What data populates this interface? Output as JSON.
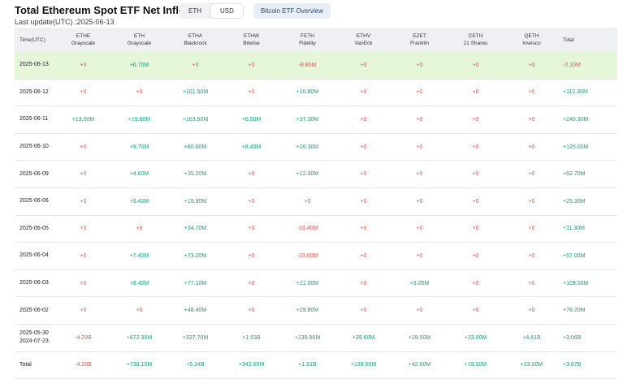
{
  "header": {
    "title": "Total Ethereum Spot ETF Net Inflow USD",
    "toggle": [
      "ETH",
      "USD"
    ],
    "toggle_active": "USD",
    "overview_button": "Bitcoin ETF Overview",
    "last_update": "Last update(UTC) :2025-06-13"
  },
  "colors": {
    "positive": "#17a37a",
    "negative": "#e05555",
    "highlight_row": "#e6f7d9",
    "header_bg": "#eef0f3"
  },
  "table": {
    "columns": [
      {
        "ticker": "Time(UTC)",
        "issuer": ""
      },
      {
        "ticker": "ETHE",
        "issuer": "Grayscale"
      },
      {
        "ticker": "ETH",
        "issuer": "Grayscale"
      },
      {
        "ticker": "ETHA",
        "issuer": "Blackrock"
      },
      {
        "ticker": "ETHW",
        "issuer": "Bitwise"
      },
      {
        "ticker": "FETH",
        "issuer": "Fidelity"
      },
      {
        "ticker": "ETHV",
        "issuer": "VanEck"
      },
      {
        "ticker": "EZET",
        "issuer": "Franklin"
      },
      {
        "ticker": "CETH",
        "issuer": "21 Shares"
      },
      {
        "ticker": "QETH",
        "issuer": "Invesco"
      },
      {
        "ticker": "Total",
        "issuer": ""
      }
    ],
    "rows": [
      {
        "date": [
          "2025-06-13"
        ],
        "values": [
          "+0",
          "+6.70M",
          "+0",
          "+0",
          "-8.80M",
          "+0",
          "+0",
          "+0",
          "+0",
          "-2.10M"
        ],
        "highlight": true
      },
      {
        "date": [
          "2025-06-12"
        ],
        "values": [
          "+0",
          "+0",
          "+101.50M",
          "+0",
          "+10.80M",
          "+0",
          "+0",
          "+0",
          "+0",
          "+112.30M"
        ]
      },
      {
        "date": [
          "2025-06-11"
        ],
        "values": [
          "+13.30M",
          "+19.60M",
          "+163.60M",
          "+6.50M",
          "+37.30M",
          "+0",
          "+0",
          "+0",
          "+0",
          "+240.30M"
        ]
      },
      {
        "date": [
          "2025-06-10"
        ],
        "values": [
          "+0",
          "+9.70M",
          "+80.60M",
          "+8.40M",
          "+26.30M",
          "+0",
          "+0",
          "+0",
          "+0",
          "+125.00M"
        ]
      },
      {
        "date": [
          "2025-06-09"
        ],
        "values": [
          "+0",
          "+4.60M",
          "+35.20M",
          "+0",
          "+12.90M",
          "+0",
          "+0",
          "+0",
          "+0",
          "+52.70M"
        ]
      },
      {
        "date": [
          "2025-06-06"
        ],
        "values": [
          "+0",
          "+9.40M",
          "+15.90M",
          "+0",
          "+0",
          "+0",
          "+0",
          "+0",
          "+0",
          "+25.30M"
        ]
      },
      {
        "date": [
          "2025-06-05"
        ],
        "values": [
          "+0",
          "+0",
          "+34.70M",
          "+0",
          "-23.40M",
          "+0",
          "+0",
          "+0",
          "+0",
          "+11.30M"
        ]
      },
      {
        "date": [
          "2025-06-04"
        ],
        "values": [
          "+0",
          "+7.40M",
          "+73.20M",
          "+0",
          "-23.60M",
          "+0",
          "+0",
          "+0",
          "+0",
          "+57.00M"
        ]
      },
      {
        "date": [
          "2025-06-03"
        ],
        "values": [
          "+0",
          "+8.40M",
          "+77.10M",
          "+0",
          "+21.00M",
          "+0",
          "+3.00M",
          "+0",
          "+0",
          "+109.50M"
        ]
      },
      {
        "date": [
          "2025-06-02"
        ],
        "values": [
          "+0",
          "+0",
          "+48.40M",
          "+0",
          "+29.80M",
          "+0",
          "+0",
          "+0",
          "+0",
          "+78.20M"
        ]
      },
      {
        "date": [
          "2025-05-30",
          "2024-07-23"
        ],
        "values": [
          "-4.29B",
          "+672.30M",
          "+327.70M",
          "+1.53B",
          "+139.50M",
          "+39.60M",
          "+19.50M",
          "+23.00M",
          "+4.61B",
          "+3.06B"
        ]
      },
      {
        "date": [
          "Total"
        ],
        "values": [
          "-4.28B",
          "+738.10M",
          "+5.24B",
          "+342.60M",
          "+1.61B",
          "+139.50M",
          "+42.60M",
          "+19.50M",
          "+23.00M",
          "+3.87B"
        ]
      }
    ]
  }
}
